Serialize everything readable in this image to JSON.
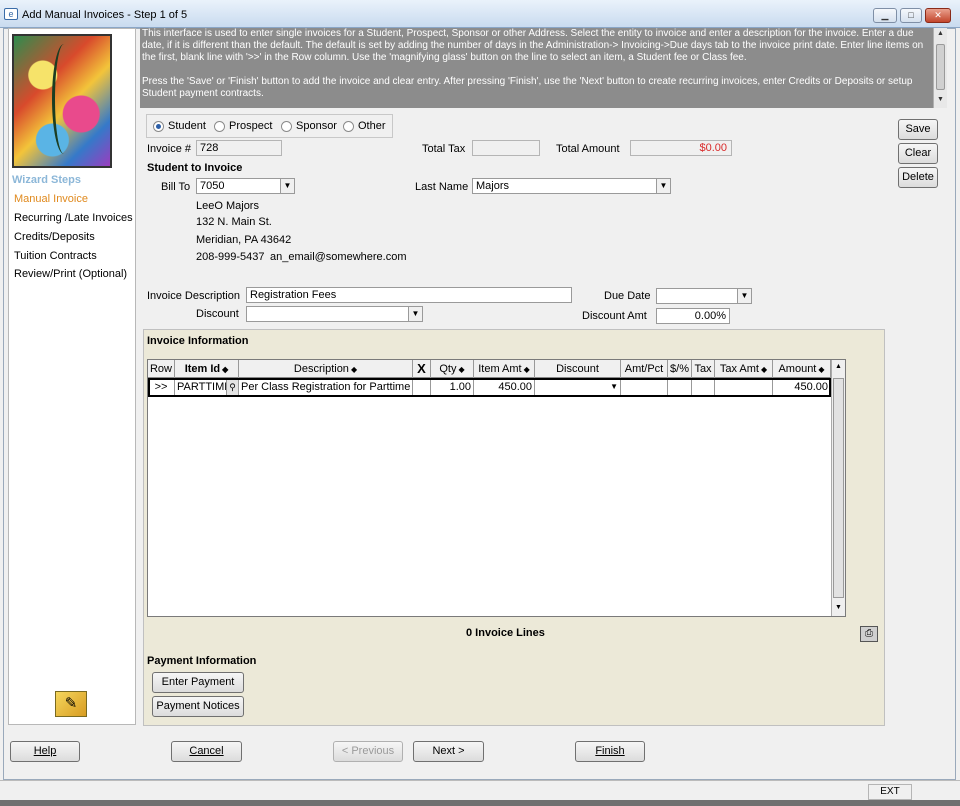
{
  "window": {
    "title": "Add Manual Invoices - Step 1 of 5"
  },
  "wizard": {
    "heading": "Wizard Steps",
    "steps": [
      {
        "label": "Manual Invoice",
        "active": true
      },
      {
        "label": "Recurring /Late Invoices",
        "active": false
      },
      {
        "label": "Credits/Deposits",
        "active": false
      },
      {
        "label": "Tuition Contracts",
        "active": false
      },
      {
        "label": "Review/Print (Optional)",
        "active": false
      }
    ]
  },
  "instructions": {
    "p1": "This interface is used to enter single invoices for a Student, Prospect, Sponsor or other Address. Select the entity to invoice and enter a description for the invoice. Enter a due date, if it is different than the default. The default is set by adding the number of days in the Administration-> Invoicing->Due days tab to the invoice print date. Enter line items on the first, blank line with '>>' in the Row column. Use the 'magnifying glass' button on the line to select an item, a Student fee or Class fee.",
    "p2": "Press the 'Save' or 'Finish' button to add the invoice and clear entry. After pressing 'Finish', use the 'Next' button to create recurring invoices, enter Credits or Deposits or setup Student payment contracts."
  },
  "entity": {
    "options": [
      "Student",
      "Prospect",
      "Sponsor",
      "Other"
    ],
    "selected": "Student"
  },
  "form": {
    "invoice_label": "Invoice #",
    "invoice_value": "728",
    "total_tax_label": "Total Tax",
    "total_tax_value": "",
    "total_amount_label": "Total Amount",
    "total_amount_value": "$0.00",
    "student_to_invoice_label": "Student to Invoice",
    "bill_to_label": "Bill To",
    "bill_to_value": "7050",
    "last_name_label": "Last Name",
    "last_name_value": "Majors",
    "address": {
      "name": "LeeO Majors",
      "street": "132 N. Main St.",
      "city": "Meridian, PA  43642",
      "phone": "208-999-5437",
      "email": "an_email@somewhere.com"
    },
    "invoice_description_label": "Invoice Description",
    "invoice_description_value": "Registration Fees",
    "due_date_label": "Due Date",
    "due_date_value": "",
    "discount_label": "Discount",
    "discount_value": "",
    "discount_amt_label": "Discount Amt",
    "discount_amt_value": "0.00%"
  },
  "side_buttons": {
    "save": "Save",
    "clear": "Clear",
    "delete": "Delete"
  },
  "invoice_info": {
    "heading": "Invoice Information",
    "columns": [
      "Row",
      "Item Id",
      "Description",
      "X",
      "Qty",
      "Item Amt",
      "Discount",
      "Amt/Pct",
      "$/%",
      "Tax",
      "Tax Amt",
      "Amount"
    ],
    "rows": [
      {
        "row": ">>",
        "item_id": "PARTTIME",
        "description": "Per Class Registration for Parttime st",
        "qty": "1.00",
        "item_amt": "450.00",
        "discount": "",
        "amt_pct": "",
        "dollar_pct": "",
        "tax": "",
        "tax_amt": "",
        "amount": "450.00"
      }
    ],
    "lines_summary": "0 Invoice Lines"
  },
  "payment": {
    "heading": "Payment Information",
    "enter_payment": "Enter Payment",
    "payment_notices": "Payment Notices"
  },
  "nav": {
    "help": "Help",
    "cancel": "Cancel",
    "previous": "< Previous",
    "next": "Next >",
    "finish": "Finish"
  },
  "status": {
    "ext": "EXT"
  }
}
